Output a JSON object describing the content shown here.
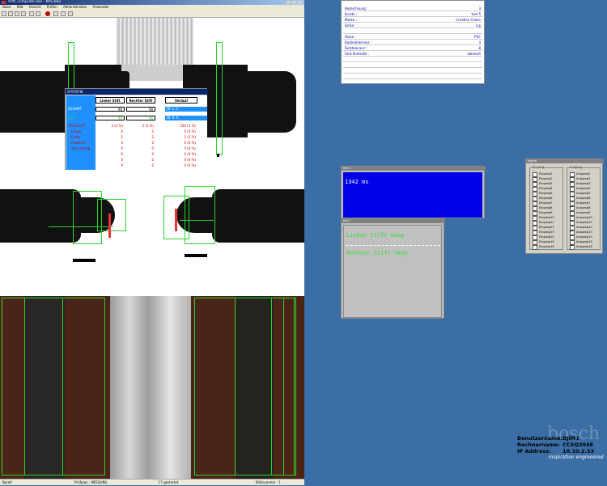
{
  "app": {
    "title": "Stift_computer.exe - KPS-602",
    "menu": [
      "Datei",
      "Bild",
      "Ansicht",
      "Prüfen",
      "Administration",
      "Anwender"
    ]
  },
  "statistik": {
    "title": "STATISTIK",
    "columns": [
      "Linker Stift",
      "Rechter Stift",
      "Verlauf"
    ],
    "gesamt": {
      "label": "GESAMT",
      "values": [
        "98",
        "98"
      ],
      "verlauf": "NF L: 0"
    },
    "gut": {
      "label": "GUT",
      "values": [
        "96",
        "96"
      ],
      "verlauf": "NF R: 0"
    },
    "schlecht": {
      "label": "SCHLECHT",
      "values": [
        "2 (2 %)",
        "2 (2 %)"
      ],
      "verlauf": "100 (1 %)"
    },
    "rows": [
      {
        "label": "Länge",
        "l": "0",
        "r": "0",
        "v": "0 (0 %)"
      },
      {
        "label": "Farbe",
        "l": "2",
        "r": "2",
        "v": "1 (1 %)"
      },
      {
        "label": "Ausbruch",
        "l": "0",
        "r": "0",
        "v": "0 (0 %)"
      },
      {
        "label": "Verrundung",
        "l": "0",
        "r": "0",
        "v": "0 (0 %)"
      },
      {
        "label": "",
        "l": "0",
        "r": "0",
        "v": "0 (0 %)"
      },
      {
        "label": "",
        "l": "0",
        "r": "0",
        "v": "0 (0 %)"
      },
      {
        "label": "",
        "l": "0",
        "r": "0",
        "v": "0 (0 %)"
      }
    ]
  },
  "status": {
    "left": "Bereit",
    "mid": "Prüfplan : MESSUNG",
    "mid2": "F7 gestartet",
    "right": "Bildnummer : 1"
  },
  "info": [
    {
      "k": "Bezeichnung :",
      "v": "3"
    },
    {
      "k": "Kunde :",
      "v": "test 5"
    },
    {
      "k": "Marke :",
      "v": "Creative Colors"
    },
    {
      "k": "Farbe :",
      "v": "Lip"
    },
    {
      "k": "",
      "v": ""
    },
    {
      "k": "Hülse :",
      "v": "PVC"
    },
    {
      "k": "Kantentoleranz :",
      "v": "4"
    },
    {
      "k": "Farbtoleranz :",
      "v": "8"
    },
    {
      "k": "Farb Kontrolle :",
      "v": "aktiviert"
    }
  ],
  "timer": {
    "title": "Intf 1",
    "value": "1342 ms"
  },
  "result": {
    "title": "Intf 2",
    "line1": "Linker Stift okay",
    "line2": "Rechter Stift okay"
  },
  "io": {
    "title": "digital",
    "eingang_title": "Eingang",
    "ausgang_title": "Ausgang",
    "eingang": [
      "Eingang1",
      "Eingang2",
      "Eingang3",
      "Eingang4",
      "Eingang5",
      "Eingang6",
      "Eingang7",
      "Eingang8",
      "Eingang9",
      "Eingang10",
      "Eingang11",
      "Eingang12",
      "Eingang13",
      "Eingang14",
      "Eingang15",
      "Eingang16"
    ],
    "ausgang": [
      "Ausgang1",
      "Ausgang2",
      "Ausgang3",
      "Ausgang4",
      "Ausgang5",
      "Ausgang6",
      "Ausgang7",
      "Ausgang8",
      "Ausgang9",
      "Ausgang10",
      "Ausgang11",
      "Ausgang12",
      "Ausgang13",
      "Ausgang14",
      "Ausgang15",
      "Ausgang16"
    ],
    "ausgang_on": [
      false,
      false,
      true,
      false,
      false,
      false,
      false,
      true,
      false,
      false,
      false,
      false,
      true,
      false,
      false,
      true
    ]
  },
  "login": {
    "user_k": "Benutzername:",
    "user_v": "BJIM1",
    "host_k": "Rechnername:",
    "host_v": "CCSQ2048",
    "ip_k": "IP Address:",
    "ip_v": "10.10.2.53"
  },
  "brand": {
    "name": "bosch",
    "tagline": "inspiration engineered"
  }
}
